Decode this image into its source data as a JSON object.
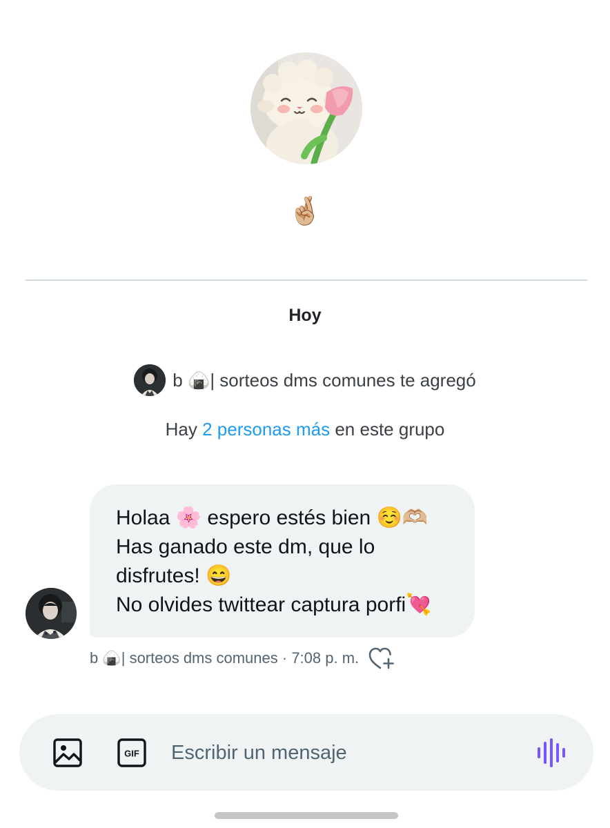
{
  "conversation": {
    "group_emoji": "🤞🏼",
    "day_label": "Hoy"
  },
  "system_messages": {
    "added_by_text": "b 🍙| sorteos dms comunes te agregó",
    "more_prefix": "Hay",
    "more_link": "2 personas más",
    "more_suffix": "en este grupo"
  },
  "message": {
    "lines": [
      "Holaa 🌸 espero estés bien ☺️🫶🏼",
      "Has ganado este dm, que lo",
      "disfrutes! 😄",
      "No olvides twittear captura porfi💘"
    ],
    "meta": "b 🍙| sorteos dms comunes · 7:08 p. m."
  },
  "composer": {
    "placeholder": "Escribir un mensaje",
    "gif_label": "GIF"
  },
  "colors": {
    "accent": "#1d9bf0",
    "bubble": "#eff3f4",
    "voice": "#7856ff",
    "secondary_text": "#536471"
  }
}
